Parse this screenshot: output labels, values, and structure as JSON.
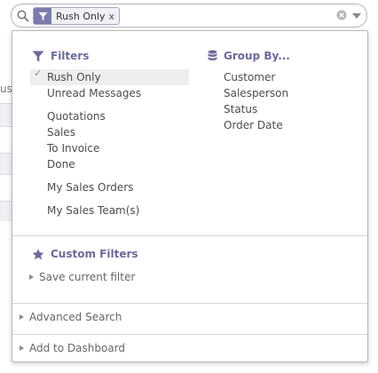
{
  "search": {
    "facet_value": "Rush Only",
    "facet_remove": "x"
  },
  "background": {
    "partial_header": "us"
  },
  "filters": {
    "title": "Filters",
    "items": [
      {
        "label": "Rush Only",
        "selected": true
      },
      {
        "label": "Unread Messages"
      },
      {
        "label": "Quotations"
      },
      {
        "label": "Sales"
      },
      {
        "label": "To Invoice"
      },
      {
        "label": "Done"
      },
      {
        "label": "My Sales Orders"
      },
      {
        "label": "My Sales Team(s)"
      }
    ]
  },
  "group_by": {
    "title": "Group By...",
    "items": [
      {
        "label": "Customer"
      },
      {
        "label": "Salesperson"
      },
      {
        "label": "Status"
      },
      {
        "label": "Order Date"
      }
    ]
  },
  "custom_filters": {
    "title": "Custom Filters",
    "save_label": "Save current filter"
  },
  "advanced_search": {
    "label": "Advanced Search"
  },
  "add_to_dashboard": {
    "label": "Add to Dashboard"
  },
  "colors": {
    "accent": "#6b6a9a",
    "facet_category": "#7c7bad",
    "selected_bg": "#eeeeee"
  },
  "icons": [
    "search-icon",
    "filter-icon",
    "database-icon",
    "star-icon",
    "clear-icon",
    "caret-down-icon"
  ]
}
